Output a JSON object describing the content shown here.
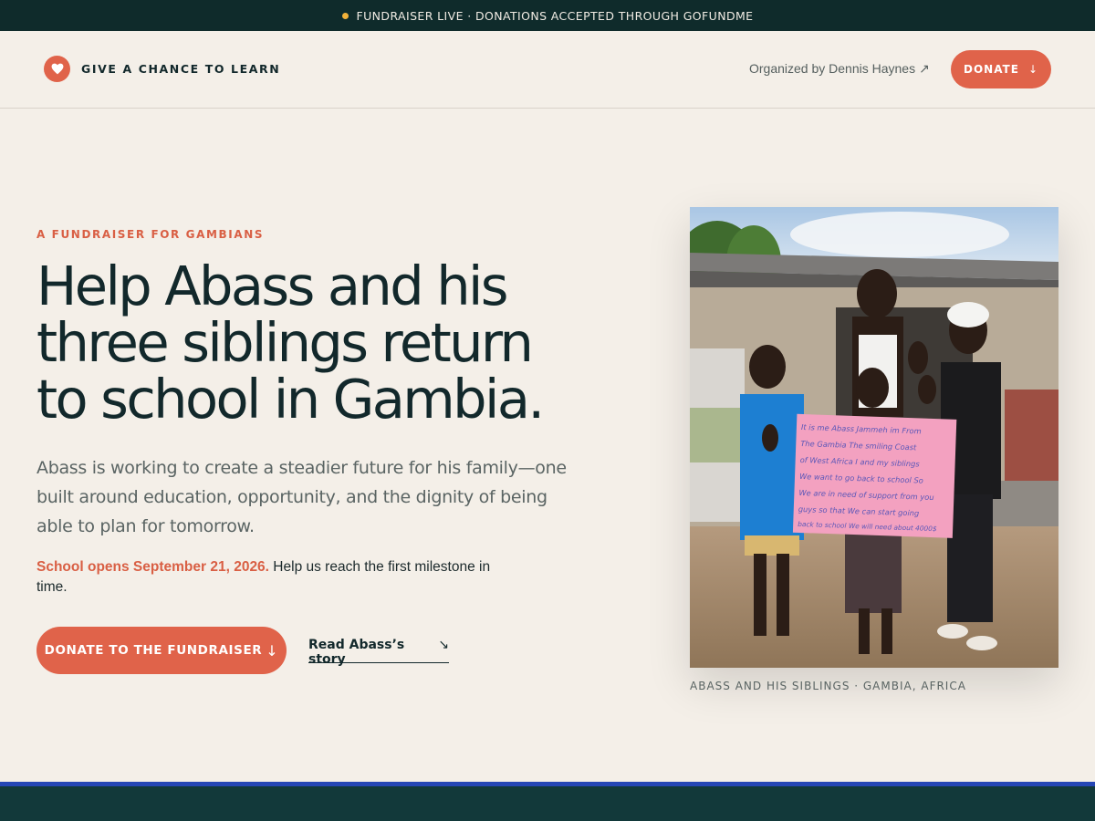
{
  "announcement": {
    "text": "FUNDRAISER LIVE · DONATIONS ACCEPTED THROUGH GOFUNDME",
    "dot_color": "#f2b23a"
  },
  "header": {
    "brand_icon": "heart-icon",
    "brand_name": "GIVE A CHANCE TO LEARN",
    "organizer_text": "Organized by Dennis Haynes",
    "organizer_arrow": "↗",
    "donate_label": "DONATE",
    "donate_arrow": "↓"
  },
  "hero": {
    "eyebrow": "A FUNDRAISER FOR GAMBIANS",
    "headline_line1": "Help Abass and his",
    "headline_line2": "three siblings return",
    "headline_line3": "to school in Gambia.",
    "lede": "Abass is working to create a steadier future for his family—one built around education, opportunity, and the dignity of being able to plan for tomorrow.",
    "note_highlight": "School opens September 21, 2026.",
    "note_text": " Help us reach the first milestone in time.",
    "primary_cta": "DONATE TO THE FUNDRAISER",
    "primary_cta_arrow": "↓",
    "secondary_link": "Read Abass’s story",
    "secondary_link_arrow": "↘"
  },
  "photo": {
    "sign_text": [
      "It is me Abass Jammeh im From",
      "The Gambia The smiling Coast",
      "of West Africa I and my siblings",
      "We want to go back to school So",
      "We are in need of support from you",
      "guys so that We can start going",
      "back to school We will need about 4000$"
    ],
    "caption": "ABASS AND HIS SIBLINGS · GAMBIA, AFRICA"
  },
  "colors": {
    "accent": "#e0634a",
    "dark": "#0f2b2b",
    "background": "#f4efe8",
    "footer": "#12393a",
    "footer_rule": "#2546b5"
  }
}
